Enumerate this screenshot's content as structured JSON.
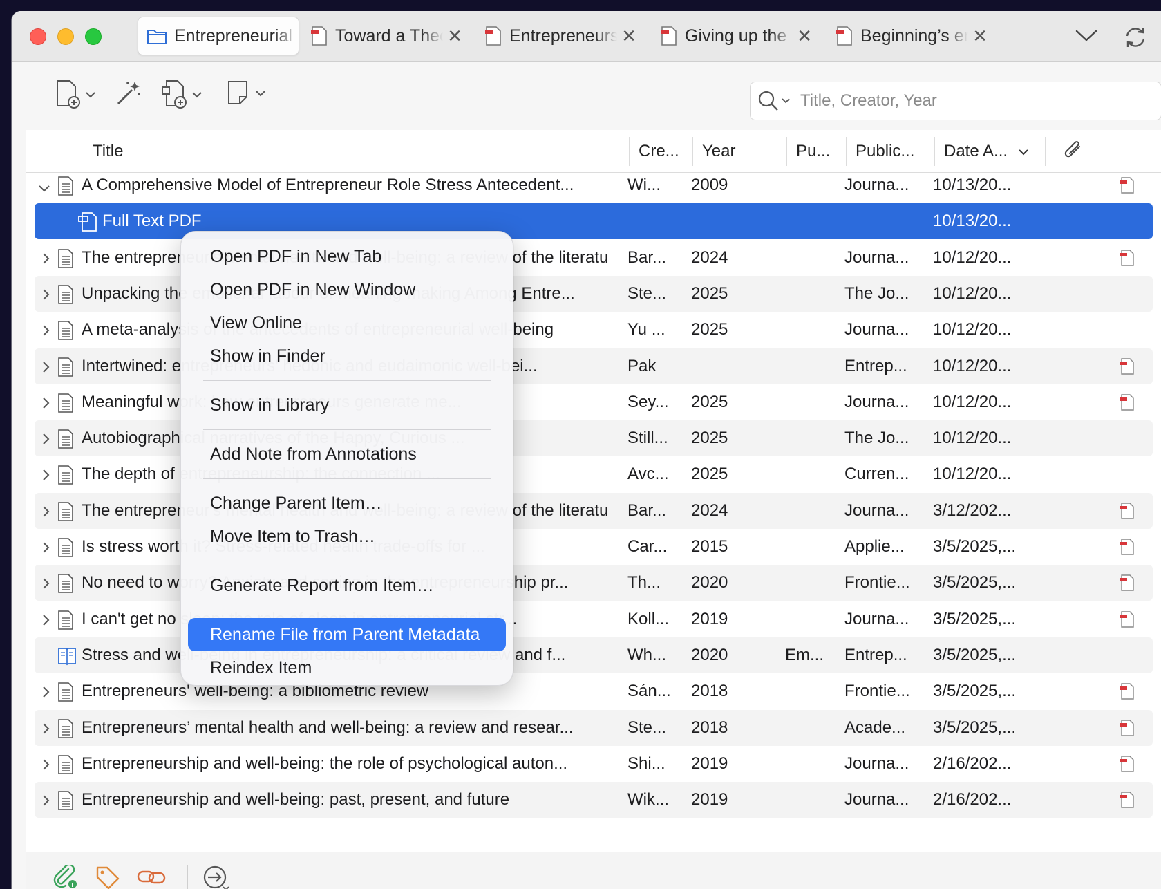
{
  "tabs": [
    {
      "label": "Entrepreneurial",
      "icon": "library-folder-icon",
      "closable": false
    },
    {
      "label": "Toward a Theory",
      "icon": "pdf-icon",
      "closable": true
    },
    {
      "label": "Entrepreneurship",
      "icon": "pdf-icon",
      "closable": true
    },
    {
      "label": "Giving up the",
      "icon": "pdf-icon",
      "closable": true
    },
    {
      "label": "Beginning’s end",
      "icon": "pdf-icon",
      "closable": true
    }
  ],
  "search": {
    "placeholder": "Title, Creator, Year",
    "value": ""
  },
  "columns": {
    "title": "Title",
    "creator": "Cre...",
    "year": "Year",
    "publisher": "Pu...",
    "publication": "Public...",
    "date_added": "Date A..."
  },
  "rows": [
    {
      "title": "A Comprehensive Model of Entrepreneur Role Stress Antecedent...",
      "creator": "Wi...",
      "year": "2009",
      "publisher": "",
      "publication": "Journa...",
      "date": "10/13/20...",
      "attachment": true,
      "expanded": true,
      "type": "document"
    },
    {
      "title": "Full Text PDF",
      "creator": "",
      "year": "",
      "publisher": "",
      "publication": "",
      "date": "10/13/20...",
      "attachment": false,
      "child": true,
      "type": "pdf",
      "selected": true
    },
    {
      "title": "The entrepreneur's mental health and well-being: a review of the literature and ...",
      "creator": "Bar...",
      "year": "2024",
      "publisher": "",
      "publication": "Journa...",
      "date": "10/12/20...",
      "attachment": true,
      "type": "document"
    },
    {
      "title": "Unpacking the emotional labour of meaning-making Among Entre...",
      "creator": "Ste...",
      "year": "2025",
      "publisher": "",
      "publication": "The Jo...",
      "date": "10/12/20...",
      "attachment": false,
      "type": "document"
    },
    {
      "title": "A meta-analysis of the antecedents of entrepreneurial well-being",
      "creator": "Yu ...",
      "year": "2025",
      "publisher": "",
      "publication": "Journa...",
      "date": "10/12/20...",
      "attachment": false,
      "type": "document"
    },
    {
      "title": "Intertwined: entrepreneurs' hedonic and eudaimonic well-bei...",
      "creator": "Pak",
      "year": "",
      "publisher": "",
      "publication": "Entrep...",
      "date": "10/12/20...",
      "attachment": true,
      "type": "document"
    },
    {
      "title": "Meaningful work: how entrepreneurs generate me...",
      "creator": "Sey...",
      "year": "2025",
      "publisher": "",
      "publication": "Journa...",
      "date": "10/12/20...",
      "attachment": true,
      "type": "document"
    },
    {
      "title": "Autobiographical narratives of the Happy, Curious ...",
      "creator": "Still...",
      "year": "2025",
      "publisher": "",
      "publication": "The Jo...",
      "date": "10/12/20...",
      "attachment": false,
      "type": "document"
    },
    {
      "title": "The depth of entrepreneurship: the connection ...",
      "creator": "Avc...",
      "year": "2025",
      "publisher": "",
      "publication": "Curren...",
      "date": "10/12/20...",
      "attachment": false,
      "type": "document"
    },
    {
      "title": "The entrepreneur's mental health and well-being: a review of the literature and ...",
      "creator": "Bar...",
      "year": "2024",
      "publisher": "",
      "publication": "Journa...",
      "date": "3/12/202...",
      "attachment": true,
      "type": "document"
    },
    {
      "title": "Is stress worth it? Stress-related health trade-offs for ...",
      "creator": "Car...",
      "year": "2015",
      "publisher": "",
      "publication": "Applie...",
      "date": "3/5/2025,...",
      "attachment": true,
      "type": "document"
    },
    {
      "title": "No need to worry? Anxiety and coping in the entrepreneurship pr...",
      "creator": "Th...",
      "year": "2020",
      "publisher": "",
      "publication": "Frontie...",
      "date": "3/5/2025,...",
      "attachment": true,
      "type": "document"
    },
    {
      "title": "I can't get no sleep: the role of sleep in entrepreneurial str...",
      "creator": "Koll...",
      "year": "2019",
      "publisher": "",
      "publication": "Journa...",
      "date": "3/5/2025,...",
      "attachment": true,
      "type": "document"
    },
    {
      "title": "Stress and well-being in entrepreneurship: a critical review and f...",
      "creator": "Wh...",
      "year": "2020",
      "publisher": "Em...",
      "publication": "Entrep...",
      "date": "3/5/2025,...",
      "attachment": false,
      "type": "book"
    },
    {
      "title": "Entrepreneurs' well-being: a bibliometric review",
      "creator": "Sán...",
      "year": "2018",
      "publisher": "",
      "publication": "Frontie...",
      "date": "3/5/2025,...",
      "attachment": true,
      "type": "document"
    },
    {
      "title": "Entrepreneurs’ mental health and well-being: a review and resear...",
      "creator": "Ste...",
      "year": "2018",
      "publisher": "",
      "publication": "Acade...",
      "date": "3/5/2025,...",
      "attachment": true,
      "type": "document"
    },
    {
      "title": "Entrepreneurship and well-being: the role of psychological auton...",
      "creator": "Shi...",
      "year": "2019",
      "publisher": "",
      "publication": "Journa...",
      "date": "2/16/202...",
      "attachment": true,
      "type": "document"
    },
    {
      "title": "Entrepreneurship and well-being: past, present, and future",
      "creator": "Wik...",
      "year": "2019",
      "publisher": "",
      "publication": "Journa...",
      "date": "2/16/202...",
      "attachment": true,
      "type": "document"
    }
  ],
  "context_menu": {
    "groups": [
      [
        "Open PDF in New Tab",
        "Open PDF in New Window",
        "View Online",
        "Show in Finder"
      ],
      [
        "Show in Library"
      ],
      [
        "Add Note from Annotations"
      ],
      [
        "Change Parent Item…",
        "Move Item to Trash…"
      ],
      [
        "Generate Report from Item…"
      ],
      [
        "Rename File from Parent Metadata",
        "Reindex Item"
      ]
    ],
    "highlighted": "Rename File from Parent Metadata"
  },
  "colors": {
    "selection": "#2c6bdc",
    "menu_highlight": "#3478f6",
    "pdf_red": "#d8363a"
  }
}
